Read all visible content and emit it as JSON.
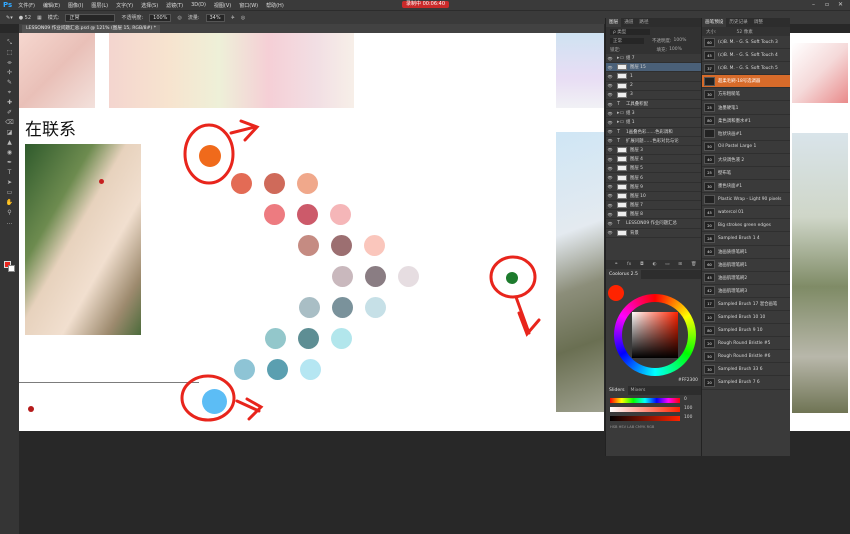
{
  "app": {
    "name": "Ps",
    "recording": "录制中 00:06:40"
  },
  "menu": [
    "文件(F)",
    "编辑(E)",
    "图像(I)",
    "图层(L)",
    "文字(Y)",
    "选择(S)",
    "滤镜(T)",
    "3D(D)",
    "视图(V)",
    "窗口(W)",
    "帮助(H)"
  ],
  "options": {
    "size": "52",
    "mode_label": "模式:",
    "mode": "正常",
    "opacity_label": "不透明度:",
    "opacity": "100%",
    "flow_label": "流量:",
    "flow": "34%"
  },
  "document": {
    "tab": "LESSON09 作业问题汇总.psd @ 121% (图层 15, RGB/8#) *",
    "title_text": "在联系"
  },
  "tools": [
    "⤡",
    "⬚",
    "⌯",
    "✢",
    "✎",
    "⌖",
    "✚",
    "✐",
    "⌫",
    "◪",
    "▲",
    "◉",
    "✒",
    "T",
    "➤",
    "▭",
    "✋",
    "⚲",
    "…"
  ],
  "layers_panel": {
    "tabs": [
      "图层",
      "通道",
      "路径"
    ],
    "kind": "ρ 类型",
    "blend": "正常",
    "opacity_label": "不透明度:",
    "opacity": "100%",
    "lock_label": "锁定:",
    "fill_label": "填充:",
    "fill": "100%",
    "rows": [
      {
        "type": "group",
        "name": "组 7"
      },
      {
        "type": "layer",
        "name": "图层 15"
      },
      {
        "type": "layer",
        "name": "1"
      },
      {
        "type": "layer",
        "name": "2"
      },
      {
        "type": "layer",
        "name": "3"
      },
      {
        "type": "text",
        "name": "工具叠积配"
      },
      {
        "type": "group",
        "name": "组 3"
      },
      {
        "type": "group",
        "name": "组 1"
      },
      {
        "type": "text",
        "name": "1画叠色彩……色彩调和"
      },
      {
        "type": "text",
        "name": "扩展问题……色彩对比与论"
      },
      {
        "type": "layer",
        "name": "图层 3"
      },
      {
        "type": "layer",
        "name": "图层 4"
      },
      {
        "type": "layer",
        "name": "图层 5"
      },
      {
        "type": "layer",
        "name": "图层 6"
      },
      {
        "type": "layer",
        "name": "图层 9"
      },
      {
        "type": "layer",
        "name": "图层 10"
      },
      {
        "type": "layer",
        "name": "图层 7"
      },
      {
        "type": "layer",
        "name": "图层 8"
      },
      {
        "type": "text",
        "name": "LESSON09 作业问题汇总"
      },
      {
        "type": "layer",
        "name": "背景"
      }
    ]
  },
  "coolorus": {
    "title": "Coolorus 2.5",
    "sliders_tabs": [
      "Sliders",
      "Mixers"
    ],
    "hex": "FF2300",
    "mode_labels": "HSB HSV LAB CMYK RGB",
    "values": [
      "0",
      "100",
      "100"
    ]
  },
  "brush_panel": {
    "tabs": [
      "画笔预设",
      "历史记录",
      "调整"
    ],
    "size_label": "大小:",
    "size": "52 像素",
    "rows": [
      {
        "size": "60",
        "name": "(c)B. M. - G. S. Soft Touch 3"
      },
      {
        "size": "45",
        "name": "(c)B. M. - G. S. Soft Touch 4"
      },
      {
        "size": "37",
        "name": "(c)B. M. - G. S. Soft Touch 5"
      },
      {
        "size": "",
        "name": "超柔毛刷-18号选调器",
        "selected": true
      },
      {
        "size": "30",
        "name": "方形粗糙笔"
      },
      {
        "size": "25",
        "name": "油墨硬笔1"
      },
      {
        "size": "80",
        "name": "柔色调和墨水#1"
      },
      {
        "size": "",
        "name": "粒状块画#1"
      },
      {
        "size": "50",
        "name": "Oil Pastel Large 1"
      },
      {
        "size": "40",
        "name": "大块调色液 2"
      },
      {
        "size": "25",
        "name": "壁布笔"
      },
      {
        "size": "30",
        "name": "墨色块面#1"
      },
      {
        "size": "",
        "name": "Plastic Wrap - Light 90 pixels"
      },
      {
        "size": "45",
        "name": "watercol 01"
      },
      {
        "size": "20",
        "name": "Big strokes green edges"
      },
      {
        "size": "28",
        "name": "Sampled Brush 1 4"
      },
      {
        "size": "40",
        "name": "油画质感笔刷1"
      },
      {
        "size": "60",
        "name": "油画肌理笔刷1"
      },
      {
        "size": "45",
        "name": "油画肌理笔刷2"
      },
      {
        "size": "42",
        "name": "油画肌理笔刷3"
      },
      {
        "size": "17",
        "name": "Sampled Brush 17 混合画笔"
      },
      {
        "size": "10",
        "name": "Sampled Brush 10 10"
      },
      {
        "size": "80",
        "name": "Sampled Brush 9 10"
      },
      {
        "size": "20",
        "name": "Rough Round Bristle #5"
      },
      {
        "size": "50",
        "name": "Rough Round Bristle #6"
      },
      {
        "size": "30",
        "name": "Sampled Brush 33 6"
      },
      {
        "size": "20",
        "name": "Sampled Brush 7 6"
      }
    ]
  },
  "swatch_colors": {
    "row1": [
      "#e36b55",
      "#cf6a5a",
      "#f0a88b"
    ],
    "row2": [
      "#ed7b80",
      "#cc5a6a",
      "#f5b6b8"
    ],
    "row3": [
      "#c58b82",
      "#9c6f71",
      "#fac6bc"
    ],
    "row4": [
      "#c9b8bd",
      "#8a7d83",
      "#e6dde1"
    ],
    "row5": [
      "#a9bec5",
      "#7a929b",
      "#c6e0e7"
    ],
    "row6": [
      "#93c7cb",
      "#5e8e94",
      "#b2e6ec"
    ],
    "row7": [
      "#8ec4d5",
      "#5b9fb0",
      "#b5e6f2"
    ],
    "annot_orange": "#f06a1b",
    "annot_blue": "#5cbdf5",
    "annot_green": "#1d7b2d",
    "annot_red": "#e8251c"
  }
}
